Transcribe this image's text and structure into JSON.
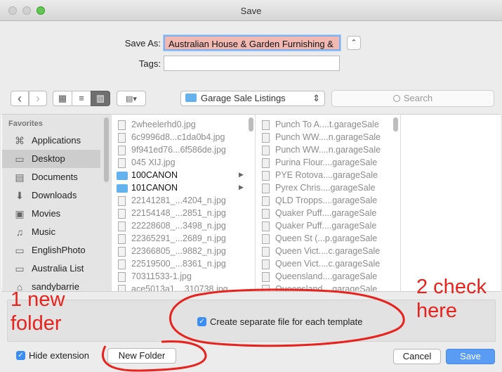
{
  "window": {
    "title": "Save"
  },
  "form": {
    "save_as_label": "Save As:",
    "save_as_value": "Australian House & Garden Furnishing &",
    "tags_label": "Tags:",
    "tags_value": "",
    "expand_glyph": "⌃"
  },
  "toolbar": {
    "back_glyph": "‹",
    "forward_glyph": "›",
    "icon_view_glyph": "▦",
    "list_view_glyph": "≡",
    "column_view_glyph": "▥",
    "gallery_glyph": "▤▾",
    "location": "Garage Sale Listings",
    "location_arrows": "⇕",
    "search_placeholder": "Search",
    "search_icon": "magnifier-icon"
  },
  "sidebar": {
    "heading": "Favorites",
    "items": [
      {
        "label": "Applications",
        "icon": "applications-icon",
        "glyph": "⌘"
      },
      {
        "label": "Desktop",
        "icon": "desktop-icon",
        "glyph": "▭"
      },
      {
        "label": "Documents",
        "icon": "documents-icon",
        "glyph": "▤"
      },
      {
        "label": "Downloads",
        "icon": "downloads-icon",
        "glyph": "⬇"
      },
      {
        "label": "Movies",
        "icon": "movies-icon",
        "glyph": "▣"
      },
      {
        "label": "Music",
        "icon": "music-icon",
        "glyph": "♫"
      },
      {
        "label": "EnglishPhoto",
        "icon": "folder-icon",
        "glyph": "▭"
      },
      {
        "label": "Australia List",
        "icon": "folder-icon",
        "glyph": "▭"
      },
      {
        "label": "sandybarrie",
        "icon": "home-icon",
        "glyph": "⌂"
      }
    ]
  },
  "column1": [
    {
      "name": "2wheelerhd0.jpg",
      "kind": "file"
    },
    {
      "name": "6c9996d8...c1da0b4.jpg",
      "kind": "file"
    },
    {
      "name": "9f941ed76...6f586de.jpg",
      "kind": "file"
    },
    {
      "name": "045 XIJ.jpg",
      "kind": "file"
    },
    {
      "name": "100CANON",
      "kind": "folder"
    },
    {
      "name": "101CANON",
      "kind": "folder"
    },
    {
      "name": "22141281_...4204_n.jpg",
      "kind": "file"
    },
    {
      "name": "22154148_...2851_n.jpg",
      "kind": "file"
    },
    {
      "name": "22228608_...3498_n.jpg",
      "kind": "file"
    },
    {
      "name": "22365291_...2689_n.jpg",
      "kind": "file"
    },
    {
      "name": "22366805_...9882_n.jpg",
      "kind": "file"
    },
    {
      "name": "22519500_...8361_n.jpg",
      "kind": "file"
    },
    {
      "name": "70311533-1.jpg",
      "kind": "file"
    },
    {
      "name": "ace5013a1....310738.jpg",
      "kind": "file"
    }
  ],
  "column2": [
    "Punch To A....t.garageSale",
    "Punch WW....n.garageSale",
    "Punch WW....n.garageSale",
    "Purina Flour....garageSale",
    "PYE Rotova....garageSale",
    "Pyrex Chris....garageSale",
    "QLD Tropps....garageSale",
    "Quaker Puff....garageSale",
    "Quaker Puff....garageSale",
    "Queen St (...p.garageSale",
    "Queen Vict....c.garageSale",
    "Queen Vict....c.garageSale",
    "Queensland....garageSale",
    "Queensland....garageSale"
  ],
  "options": {
    "separate_file_label": "Create separate file for each template",
    "separate_file_checked": true
  },
  "footer": {
    "hide_extension_label": "Hide extension",
    "hide_extension_checked": true,
    "new_folder_label": "New Folder",
    "cancel_label": "Cancel",
    "save_label": "Save"
  },
  "annotations": {
    "note1": "1 new folder",
    "note2": "2 check here",
    "color": "#e8231e"
  },
  "colors": {
    "accent": "#5a9bf4",
    "folder": "#63b2ee",
    "selection_fill": "#f2b9b3"
  }
}
